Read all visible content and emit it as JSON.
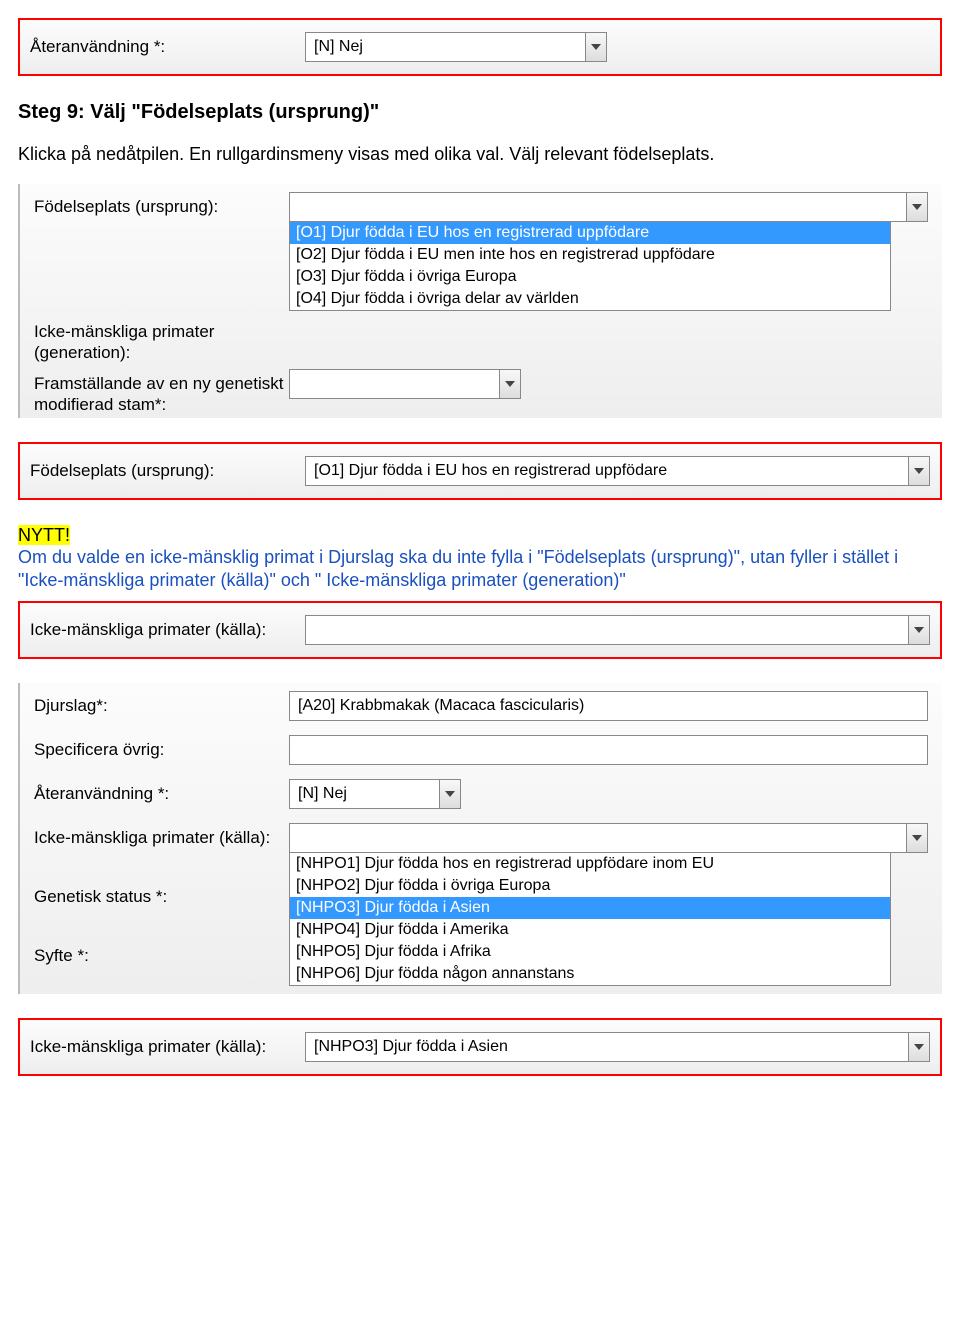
{
  "block1": {
    "reuse_label": "Återanvändning *:",
    "reuse_value": "[N] Nej"
  },
  "step9": {
    "heading": "Steg 9: Välj \"Födelseplats (ursprung)\"",
    "body": "Klicka på nedåtpilen. En rullgardinsmeny visas med olika val. Välj relevant födelseplats."
  },
  "block2": {
    "label_birthplace": "Födelseplats (ursprung):",
    "label_nhp_gen": "Icke-mänskliga primater (generation):",
    "label_framst": "Framställande av en ny genetiskt modifierad stam*:",
    "options": [
      "[O1] Djur födda i EU hos en registrerad uppfödare",
      "[O2] Djur födda i EU men inte hos en registrerad uppfödare",
      "[O3] Djur födda i övriga Europa",
      "[O4] Djur födda i övriga delar av världen"
    ]
  },
  "block3": {
    "label": "Födelseplats (ursprung):",
    "value": "[O1] Djur födda i EU hos en registrerad uppfödare"
  },
  "note": {
    "nytt": "NYTT!",
    "text": "Om du valde en icke-mänsklig primat i Djurslag ska du inte fylla i \"Födelseplats (ursprung)\", utan fyller i stället i \"Icke-mänskliga primater (källa)\" och \" Icke-mänskliga primater (generation)\""
  },
  "block4": {
    "label": "Icke-mänskliga primater (källa):",
    "value": ""
  },
  "block5": {
    "label_djurslag": "Djurslag*:",
    "val_djurslag": "[A20] Krabbmakak (Macaca fascicularis)",
    "label_spec": "Specificera övrig:",
    "label_reuse": "Återanvändning *:",
    "val_reuse": "[N] Nej",
    "label_nhp_src": "Icke-mänskliga primater (källa):",
    "label_genstatus": "Genetisk status *:",
    "label_syfte": "Syfte *:",
    "nhp_options": [
      "[NHPO1] Djur födda hos en registrerad uppfödare inom EU",
      "[NHPO2] Djur födda i övriga Europa",
      "[NHPO3] Djur födda i Asien",
      "[NHPO4] Djur födda i Amerika",
      "[NHPO5] Djur födda i Afrika",
      "[NHPO6] Djur födda någon annanstans"
    ],
    "nhp_selected_index": 2
  },
  "block6": {
    "label": "Icke-mänskliga primater (källa):",
    "value": "[NHPO3] Djur födda i Asien"
  }
}
